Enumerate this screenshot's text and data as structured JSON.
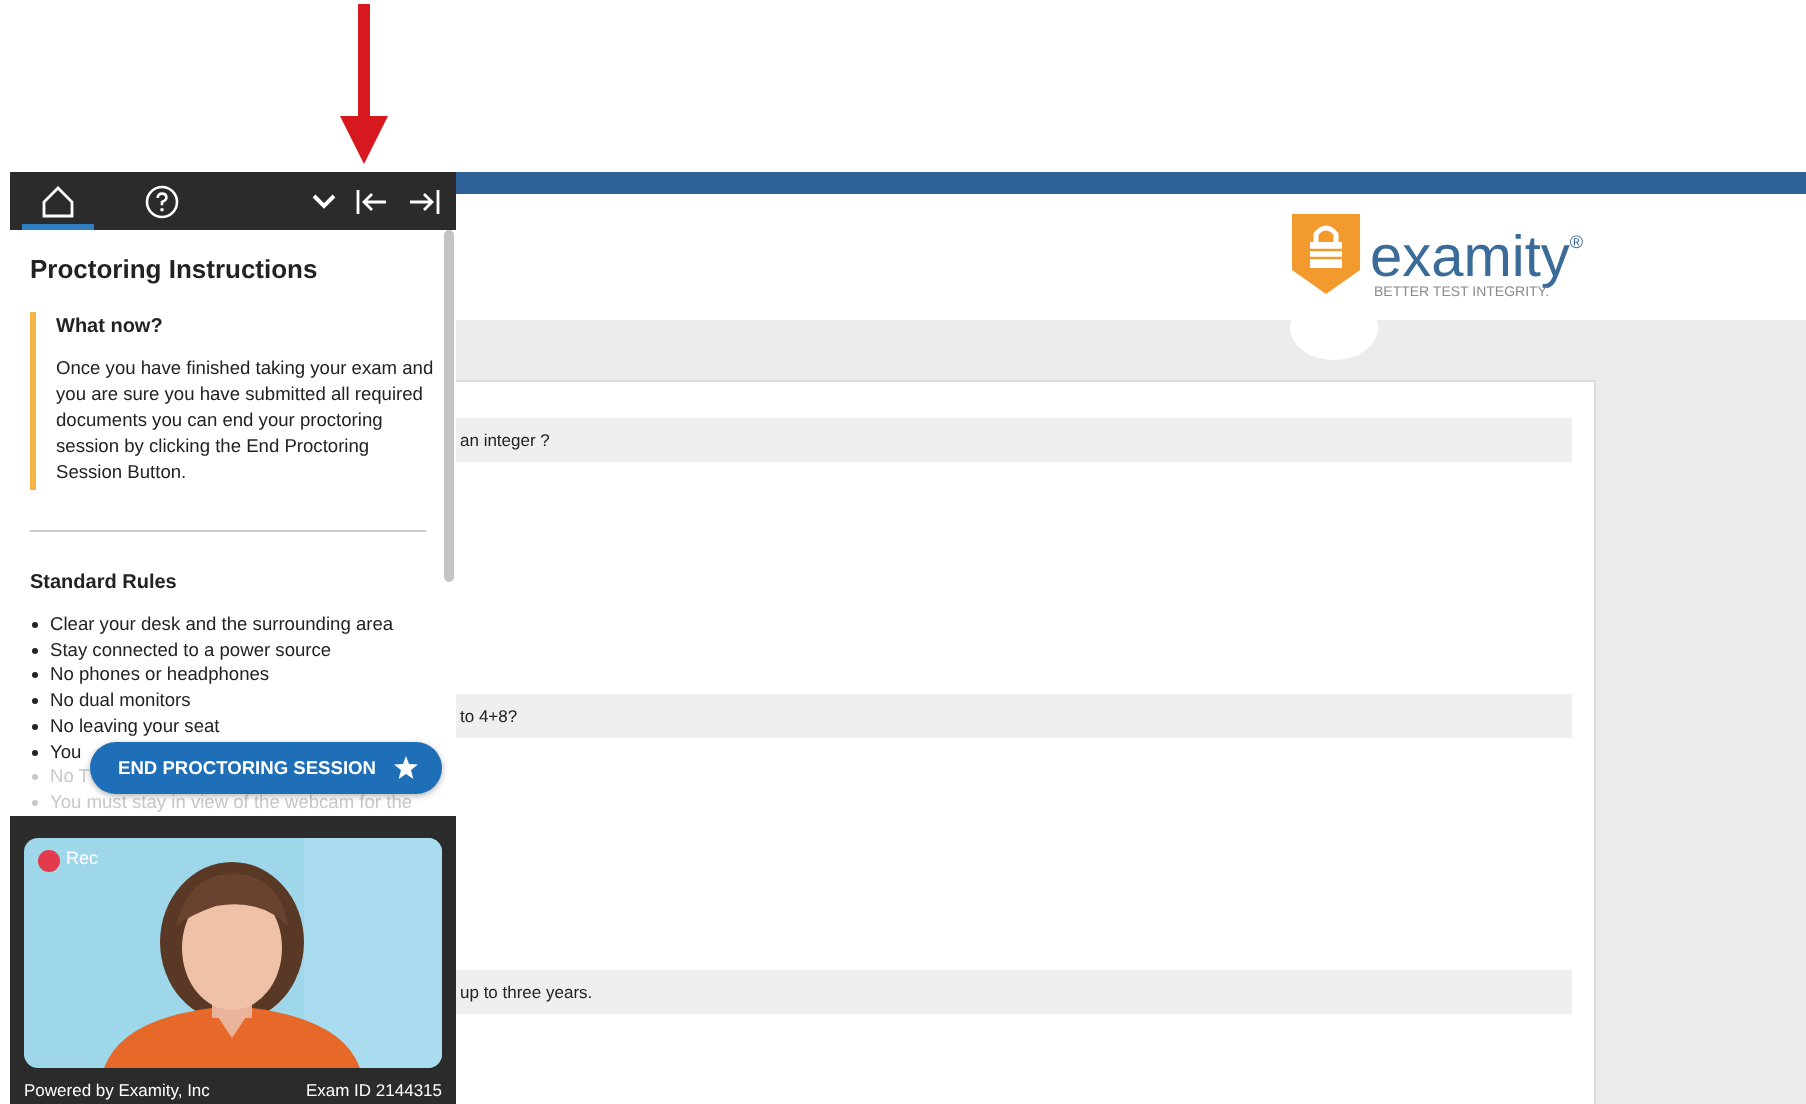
{
  "sidebar": {
    "tabs": [
      {
        "kind": "home",
        "selected": true
      },
      {
        "kind": "help",
        "selected": false
      }
    ],
    "title": "Proctoring Instructions",
    "callout": {
      "heading": "What now?",
      "body": "Once you have finished taking your exam and you are sure you have submitted all required documents you can end your proctoring session by clicking the End Proctoring Session Button."
    },
    "rules": {
      "heading": "Standard Rules",
      "items": [
        {
          "text": "Clear your desk and the surrounding area",
          "faded": false
        },
        {
          "text": "Stay connected to a power source",
          "faded": false
        },
        {
          "text": "No phones or headphones",
          "faded": false
        },
        {
          "text": "No dual monitors",
          "faded": false
        },
        {
          "text": "No leaving your seat",
          "faded": false
        },
        {
          "text": "You",
          "faded": false
        },
        {
          "text": "No T",
          "faded": true
        },
        {
          "text": "You must stay in view of the webcam for the",
          "faded": true
        }
      ]
    },
    "end_button": "END PROCTORING SESSION",
    "webcam": {
      "kind": "picture",
      "recording_label": "Rec"
    },
    "footer": {
      "powered_by": "Powered by Examity, Inc",
      "exam_id": "Exam ID 2144315"
    }
  },
  "header": {
    "logo_name": "examity$^{®}$",
    "tagline": "BETTER TEST INTEGRITY."
  },
  "questions": [
    "an integer ?",
    "to 4+8?",
    "up to three years."
  ]
}
